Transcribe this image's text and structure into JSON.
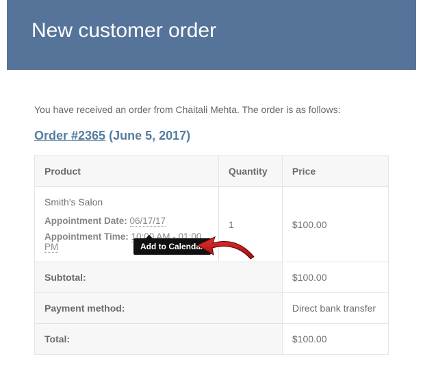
{
  "header": {
    "title": "New customer order"
  },
  "intro": "You have received an order from Chaitali Mehta. The order is as follows:",
  "order": {
    "link_text": "Order #2365",
    "date_text": "(June 5, 2017)"
  },
  "table": {
    "headers": {
      "product": "Product",
      "quantity": "Quantity",
      "price": "Price"
    },
    "item": {
      "name": "Smith's Salon",
      "appt_date_label": "Appointment Date:",
      "appt_date_value": "06/17/17",
      "appt_time_label": "Appointment Time:",
      "appt_time_value": "10:00 AM - 01:00 PM",
      "quantity": "1",
      "price": "$100.00"
    },
    "subtotal_label": "Subtotal:",
    "subtotal_value": "$100.00",
    "payment_label": "Payment method:",
    "payment_value": "Direct bank transfer",
    "total_label": "Total:",
    "total_value": "$100.00"
  },
  "tooltip": {
    "text": "Add to Calendar"
  }
}
